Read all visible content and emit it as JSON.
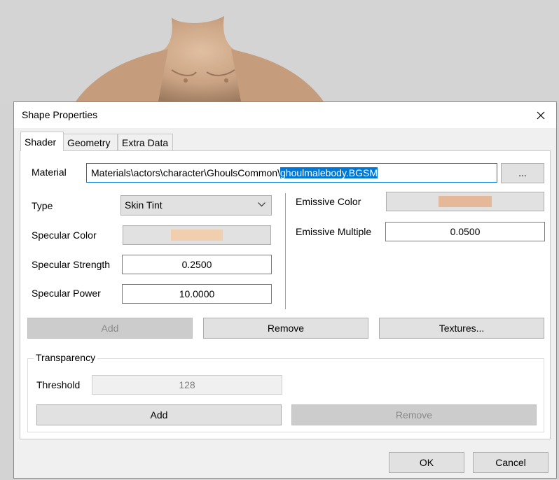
{
  "dialog": {
    "title": "Shape Properties",
    "close_icon": "close-icon"
  },
  "tabs": [
    {
      "label": "Shader",
      "active": true
    },
    {
      "label": "Geometry",
      "active": false
    },
    {
      "label": "Extra Data",
      "active": false
    }
  ],
  "shader": {
    "material": {
      "label": "Material",
      "path_prefix": "Materials\\actors\\character\\GhoulsCommon\\",
      "path_selected": "ghoulmalebody.BGSM",
      "browse_label": "..."
    },
    "type": {
      "label": "Type",
      "value": "Skin Tint"
    },
    "specular_color": {
      "label": "Specular Color",
      "color": "#f1cfae"
    },
    "specular_strength": {
      "label": "Specular Strength",
      "value": "0.2500"
    },
    "specular_power": {
      "label": "Specular Power",
      "value": "10.0000"
    },
    "emissive_color": {
      "label": "Emissive Color",
      "color": "#e6b89a"
    },
    "emissive_multiple": {
      "label": "Emissive Multiple",
      "value": "0.0500"
    },
    "buttons": {
      "add": "Add",
      "remove": "Remove",
      "textures": "Textures..."
    }
  },
  "transparency": {
    "group_label": "Transparency",
    "threshold_label": "Threshold",
    "threshold_value": "128",
    "add": "Add",
    "remove": "Remove"
  },
  "footer": {
    "ok": "OK",
    "cancel": "Cancel"
  },
  "colors": {
    "accent": "#0078d7",
    "skin": "#c7a17d"
  }
}
